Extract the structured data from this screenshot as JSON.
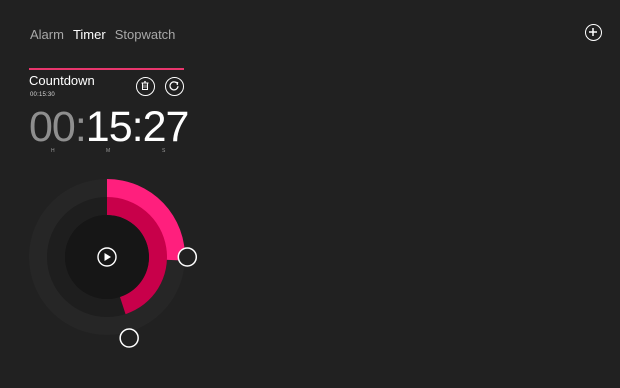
{
  "tabs": [
    {
      "label": "Alarm",
      "active": false
    },
    {
      "label": "Timer",
      "active": true
    },
    {
      "label": "Stopwatch",
      "active": false
    }
  ],
  "add_button_icon": "plus-icon",
  "timer": {
    "name": "Countdown",
    "duration": "00:15:30",
    "display": {
      "hours": "00",
      "minutes": "15",
      "seconds": "27"
    },
    "units": {
      "h": "H",
      "m": "M",
      "s": "S"
    },
    "progress": {
      "minutes_fraction": 0.2575,
      "seconds_fraction": 0.45
    }
  },
  "icons": {
    "delete": "trash-icon",
    "reset": "refresh-icon",
    "play": "play-icon"
  },
  "colors": {
    "background": "#212121",
    "accent": "#ff1f7d",
    "accent_dark": "#c8004a",
    "ring_outer": "#262626",
    "ring_mid": "#1e1e1e",
    "ring_inner": "#161616"
  }
}
